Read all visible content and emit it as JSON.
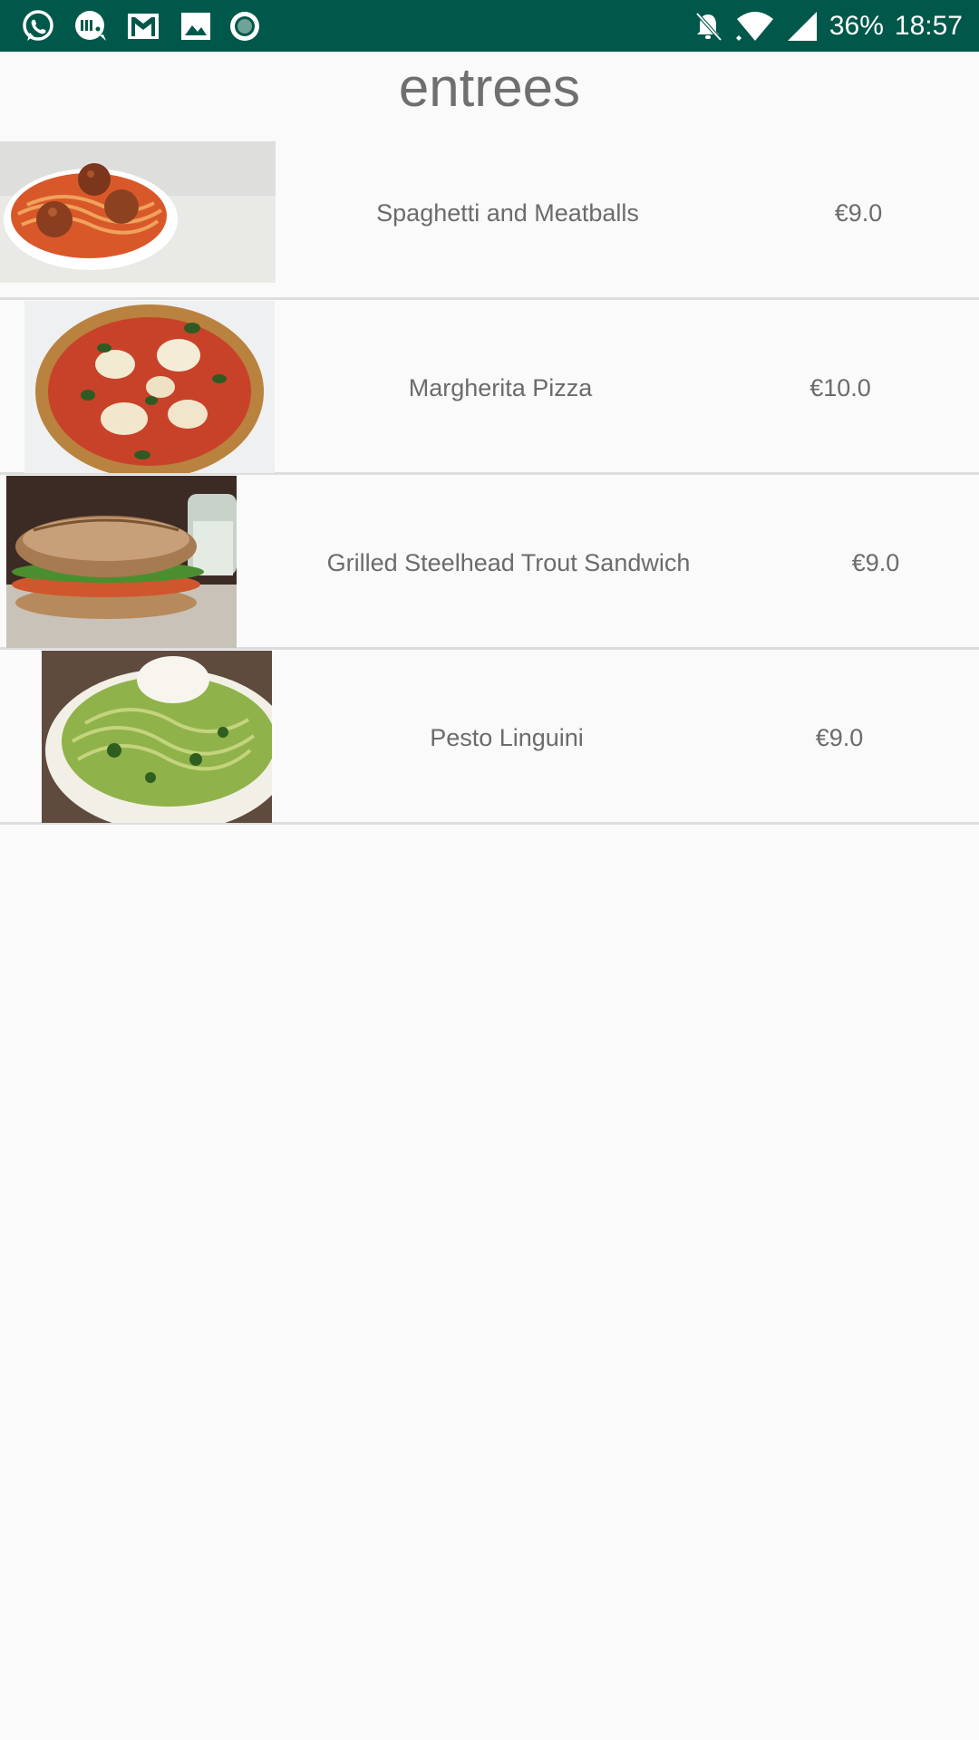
{
  "status_bar": {
    "battery_text": "36%",
    "time_text": "18:57",
    "left_icons": [
      "whatsapp-icon",
      "messaging-app-icon",
      "gmail-icon",
      "gallery-icon",
      "circle-app-icon"
    ],
    "right_icons": [
      "notifications-off-icon",
      "wifi-icon",
      "cell-signal-icon"
    ]
  },
  "page": {
    "title": "entrees"
  },
  "menu": {
    "items": [
      {
        "name": "Spaghetti and Meatballs",
        "price": "€9.0",
        "image": "spaghetti-meatballs-photo"
      },
      {
        "name": "Margherita Pizza",
        "price": "€10.0",
        "image": "margherita-pizza-photo"
      },
      {
        "name": "Grilled Steelhead Trout Sandwich",
        "price": "€9.0",
        "image": "trout-sandwich-photo"
      },
      {
        "name": "Pesto Linguini",
        "price": "€9.0",
        "image": "pesto-linguini-photo"
      }
    ]
  },
  "colors": {
    "status_bar_bg": "#00584a",
    "background": "#fafafa",
    "text": "#6b6b6b",
    "divider": "#dddddd"
  }
}
